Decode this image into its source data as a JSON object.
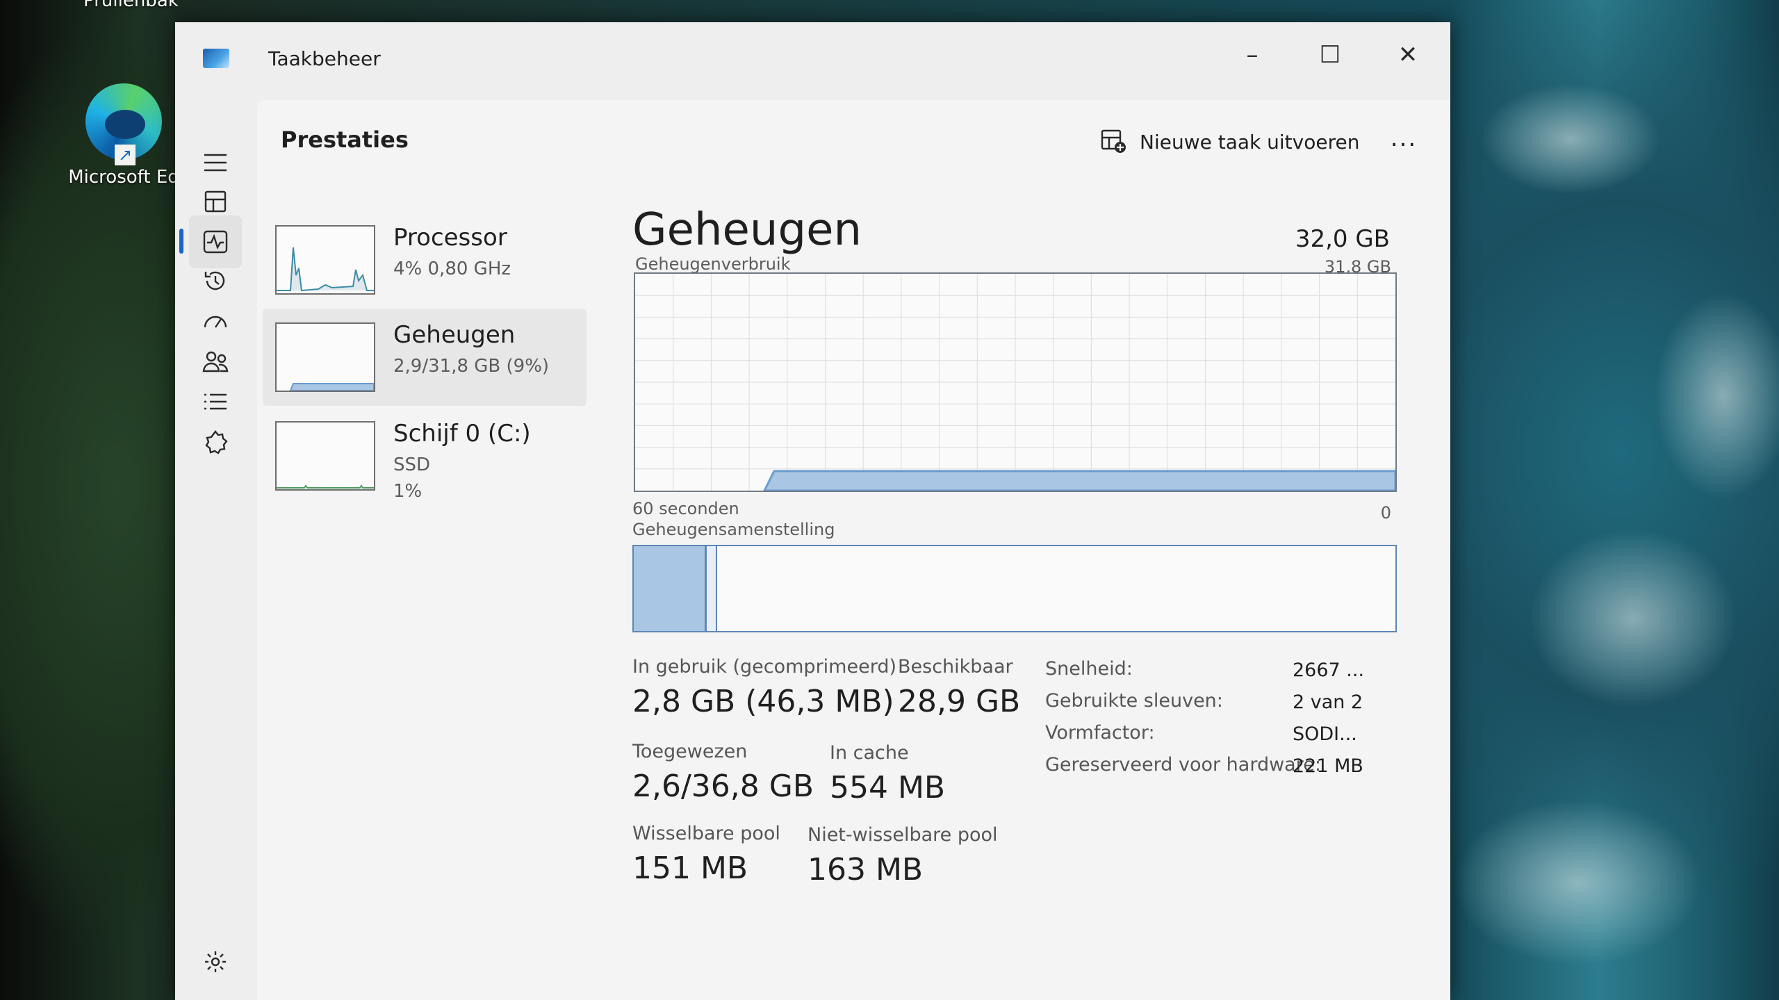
{
  "desktop": {
    "recycle_bin_label": "Prullenbak",
    "edge_label": "Microsoft Ed"
  },
  "window": {
    "title": "Taakbeheer",
    "controls": {
      "minimize": "–",
      "maximize": "☐",
      "close": "✕"
    }
  },
  "nav": {
    "items": [
      {
        "icon": "hamburger-menu-icon"
      },
      {
        "icon": "processes-icon"
      },
      {
        "icon": "performance-icon",
        "active": true
      },
      {
        "icon": "app-history-icon"
      },
      {
        "icon": "startup-apps-icon"
      },
      {
        "icon": "users-icon"
      },
      {
        "icon": "details-icon"
      },
      {
        "icon": "services-icon"
      },
      {
        "icon": "settings-icon"
      }
    ]
  },
  "header": {
    "title": "Prestaties",
    "run_task_label": "Nieuwe taak uitvoeren",
    "more_label": "..."
  },
  "devices": [
    {
      "name": "Processor",
      "sub1": "4% 0,80 GHz",
      "sub2": ""
    },
    {
      "name": "Geheugen",
      "sub1": "2,9/31,8 GB (9%)",
      "sub2": "",
      "selected": true
    },
    {
      "name": "Schijf 0 (C:)",
      "sub1": "SSD",
      "sub2": "1%"
    }
  ],
  "memory": {
    "title": "Geheugen",
    "total": "32,0 GB",
    "usage_label": "Geheugenverbruik",
    "usage_max": "31,8 GB",
    "time_label": "60 seconden",
    "time_zero": "0",
    "composition_label": "Geheugensamenstelling",
    "usage_fraction": 0.09,
    "stats": {
      "in_use_label": "In gebruik (gecomprimeerd)",
      "in_use_value": "2,8 GB (46,3 MB)",
      "available_label": "Beschikbaar",
      "available_value": "28,9 GB",
      "committed_label": "Toegewezen",
      "committed_value": "2,6/36,8 GB",
      "cached_label": "In cache",
      "cached_value": "554 MB",
      "paged_label": "Wisselbare pool",
      "paged_value": "151 MB",
      "nonpaged_label": "Niet-wisselbare pool",
      "nonpaged_value": "163 MB"
    },
    "props": [
      {
        "label": "Snelheid:",
        "value": "2667 ..."
      },
      {
        "label": "Gebruikte sleuven:",
        "value": "2 van 2"
      },
      {
        "label": "Vormfactor:",
        "value": "SODI..."
      },
      {
        "label": "Gereserveerd voor hardware:",
        "value": "221 MB"
      }
    ]
  },
  "colors": {
    "accent": "#1667c6",
    "memory_fill": "#a9c6e4",
    "memory_stroke": "#6a9cd0"
  }
}
